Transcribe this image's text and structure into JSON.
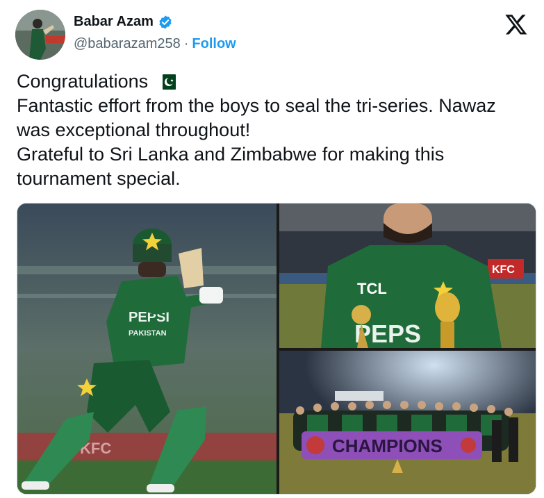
{
  "author": {
    "display_name": "Babar Azam",
    "handle": "@babarazam258",
    "separator": "·",
    "follow_label": "Follow",
    "verified_color": "#1d9bf0"
  },
  "platform_icon": "x-logo-icon",
  "tweet": {
    "lines": [
      "Congratulations",
      "Fantastic effort from the boys to seal the tri-series. Nawaz",
      "was exceptional throughout!",
      "Grateful to Sri Lanka and Zimbabwe for making this",
      "tournament special."
    ],
    "emoji": "pakistan-flag-icon"
  },
  "media": {
    "photo_1": {
      "jersey_text": "PEPSI",
      "jersey_sub": "PAKISTAN",
      "board_text": "KFC"
    },
    "photo_2": {
      "sponsor_text": "TCL",
      "jersey_text": "PEPS",
      "board_text": "KFC"
    },
    "photo_3": {
      "banner_text": "CHAMPIONS"
    }
  },
  "colors": {
    "accent": "#1d9bf0",
    "text": "#0f1419",
    "muted": "#536471",
    "jersey_green": "#1f6b3a",
    "flag_green": "#01411c"
  }
}
